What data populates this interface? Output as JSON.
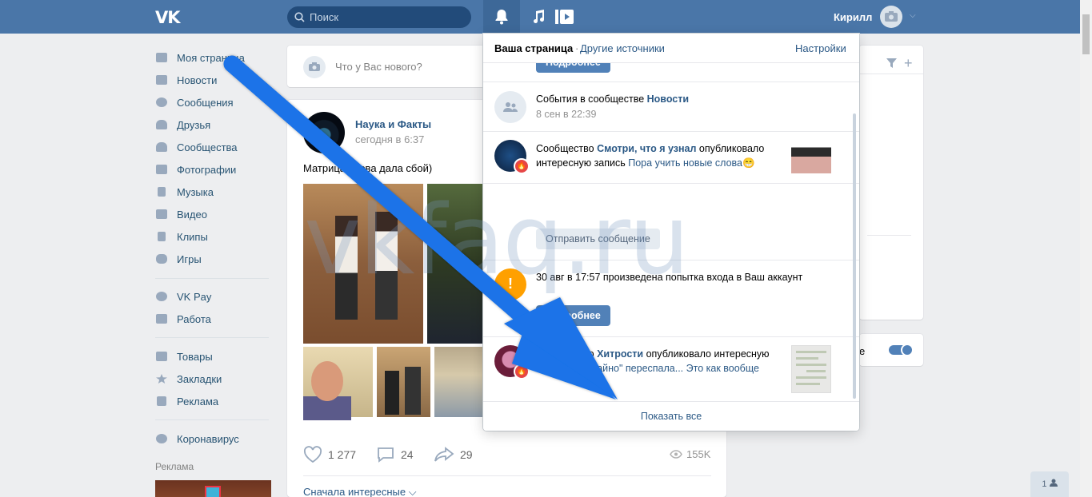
{
  "header": {
    "logo": "VK",
    "search_placeholder": "Поиск",
    "user_name": "Кирилл"
  },
  "sidebar": {
    "items": [
      {
        "label": "Моя страница",
        "icon": "home-icon"
      },
      {
        "label": "Новости",
        "icon": "news-icon"
      },
      {
        "label": "Сообщения",
        "icon": "messages-icon"
      },
      {
        "label": "Друзья",
        "icon": "friends-icon"
      },
      {
        "label": "Сообщества",
        "icon": "groups-icon"
      },
      {
        "label": "Фотографии",
        "icon": "photos-icon"
      },
      {
        "label": "Музыка",
        "icon": "music-icon"
      },
      {
        "label": "Видео",
        "icon": "video-icon"
      },
      {
        "label": "Клипы",
        "icon": "clips-icon"
      },
      {
        "label": "Игры",
        "icon": "games-icon"
      },
      {
        "label": "VK Pay",
        "icon": "vkpay-icon"
      },
      {
        "label": "Работа",
        "icon": "work-icon"
      },
      {
        "label": "Товары",
        "icon": "goods-icon"
      },
      {
        "label": "Закладки",
        "icon": "bookmarks-icon"
      },
      {
        "label": "Реклама",
        "icon": "ads-icon"
      },
      {
        "label": "Коронавирус",
        "icon": "virus-icon"
      }
    ],
    "ad_label": "Реклама"
  },
  "compose": {
    "placeholder": "Что у Вас нового?"
  },
  "post": {
    "author": "Наука и Факты",
    "date": "сегодня в 6:37",
    "text": "Матрица снова дала сбой)",
    "likes": "1 277",
    "comments": "24",
    "shares": "29",
    "views": "155K",
    "sort_label": "Сначала интересные ⌵"
  },
  "right": {
    "toggle_text": "е"
  },
  "chat": {
    "count": "1"
  },
  "notifications": {
    "tab_mine": "Ваша страница",
    "tab_other": "Другие источники",
    "settings": "Настройки",
    "top_button": "Подробнее",
    "items": [
      {
        "text_prefix": "События в сообществе ",
        "link": "Новости",
        "date": "8 сен в 22:39"
      },
      {
        "text_prefix": "Сообщество ",
        "link": "Смотри, что я узнал",
        "text_mid": " опубликовало интересную запись ",
        "link2": "Пора учить новые слова😁"
      },
      {
        "button": "Отправить сообщение"
      },
      {
        "text": "30 авг в 17:57 произведена попытка входа в Ваш аккаунт",
        "button": "Подробнее"
      },
      {
        "text_prefix": "Сообщество ",
        "link": "Хитрости",
        "text_mid": " опубликовало интересную запись ",
        "link2": "\"Случайно\" переспала... Это как вообще"
      }
    ],
    "show_all": "Показать все"
  },
  "watermark": "vkfaq.ru"
}
